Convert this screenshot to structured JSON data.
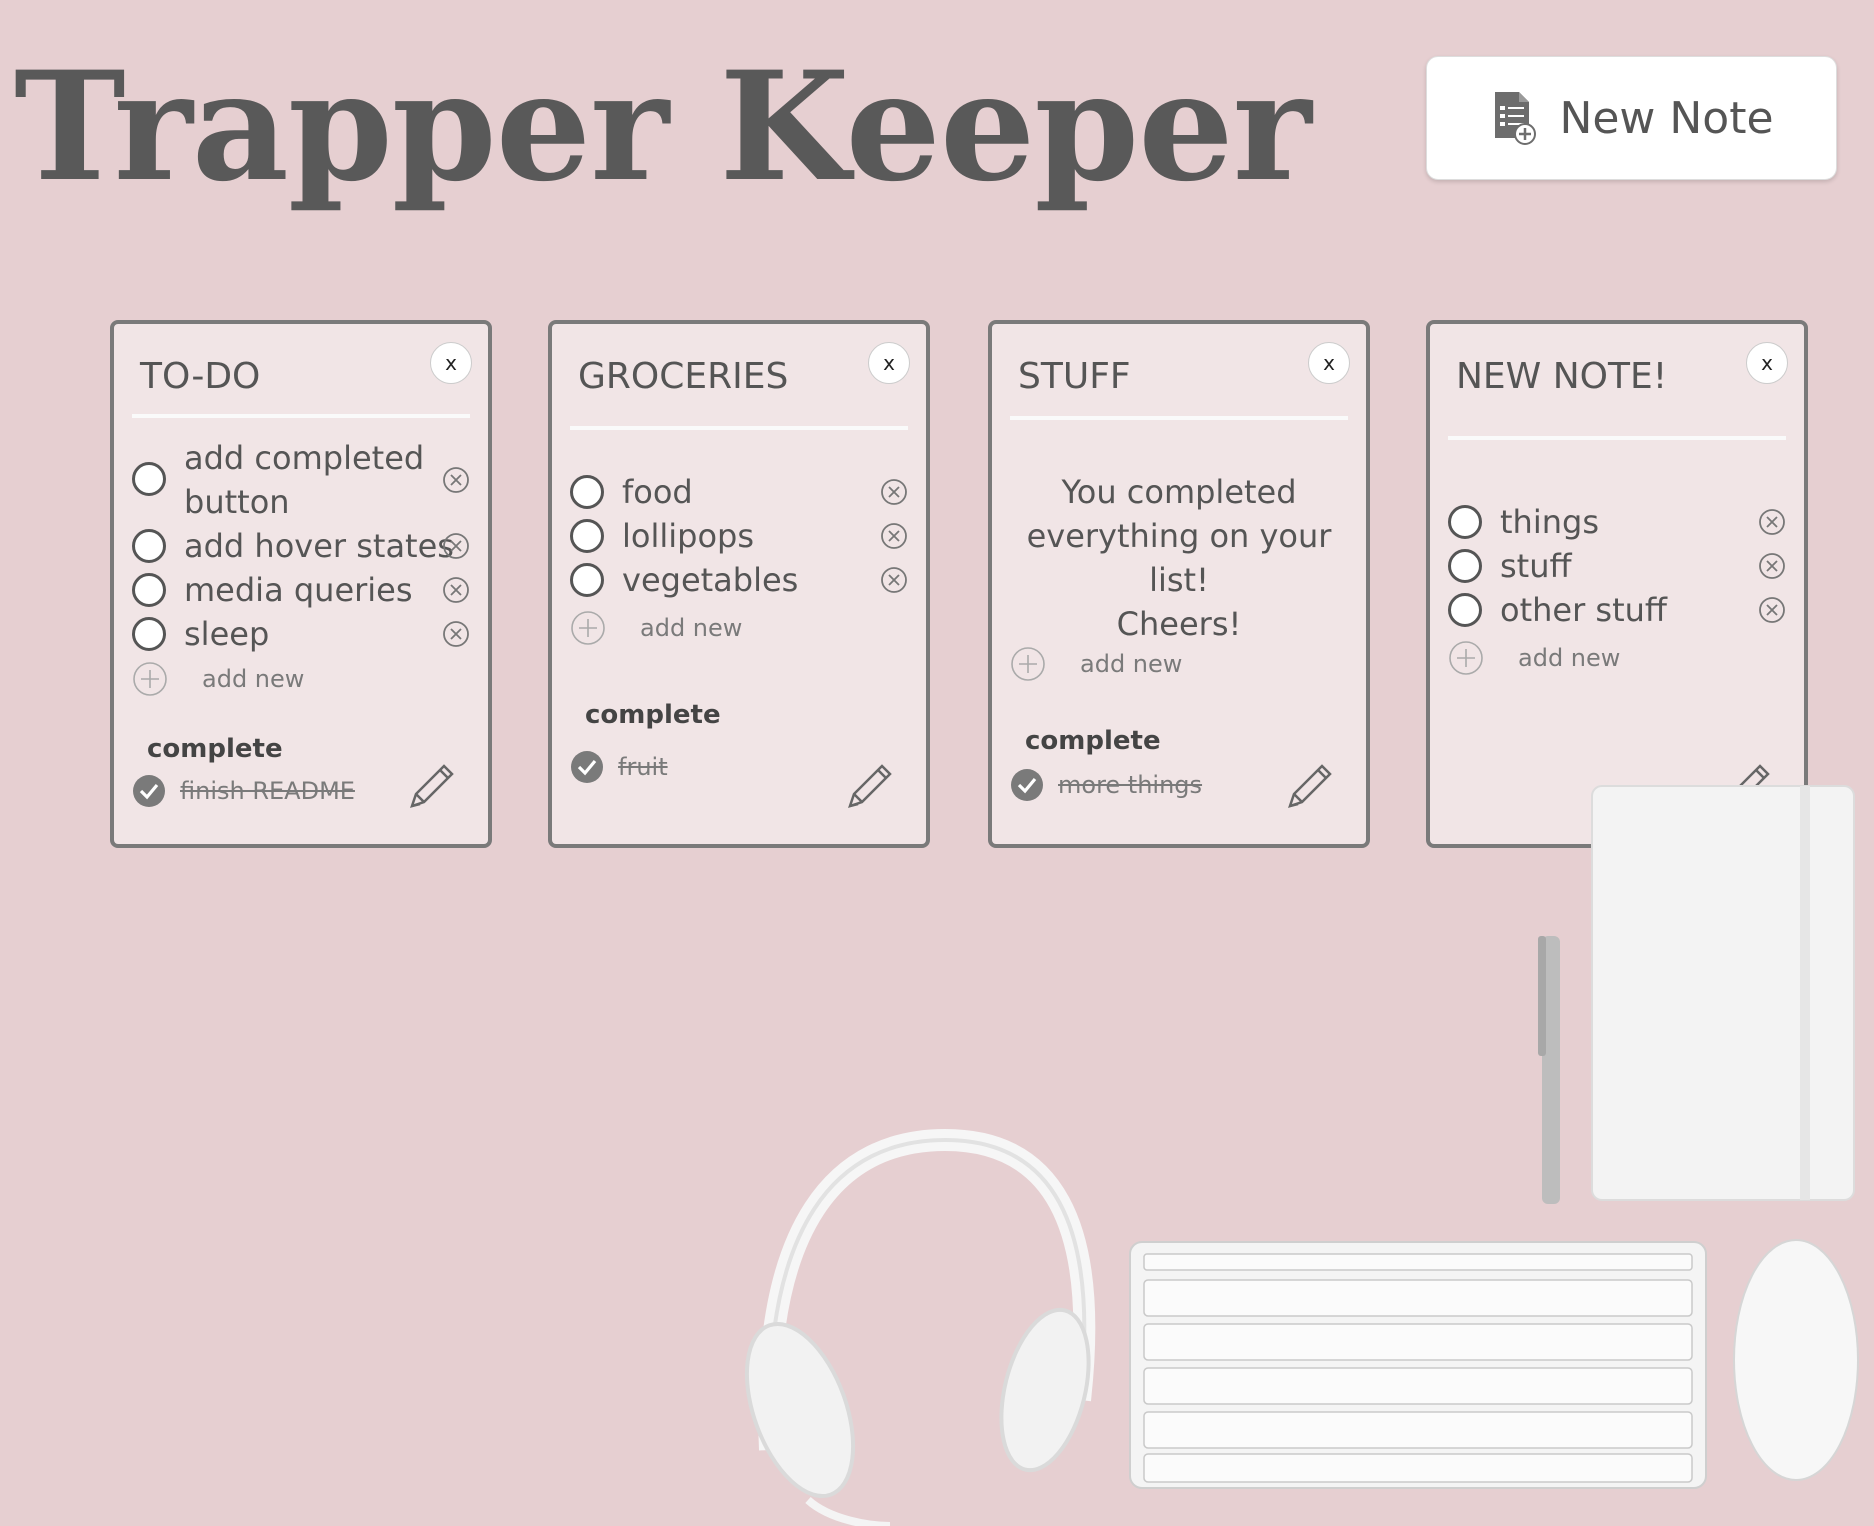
{
  "app": {
    "title": "Trapper Keeper",
    "new_note_label": "New Note"
  },
  "notes": [
    {
      "title": "TO-DO",
      "close_label": "x",
      "items": [
        "add completed",
        "button",
        "add hover states",
        "media queries",
        "sleep"
      ],
      "add_label": "add new",
      "complete_label": "complete",
      "completed": [
        "finish README"
      ]
    },
    {
      "title": "GROCERIES",
      "close_label": "x",
      "items": [
        "food",
        "lollipops",
        "vegetables"
      ],
      "add_label": "add new",
      "complete_label": "complete",
      "completed": [
        "fruit"
      ]
    },
    {
      "title": "STUFF",
      "close_label": "x",
      "empty_message": [
        "You completed",
        "everything on your list!",
        "Cheers!"
      ],
      "add_label": "add new",
      "complete_label": "complete",
      "completed": [
        "more things"
      ]
    },
    {
      "title": "NEW NOTE!",
      "close_label": "x",
      "items": [
        "things",
        "stuff",
        "other stuff"
      ],
      "add_label": "add new"
    }
  ],
  "colors": {
    "background": "#e6cfd1",
    "card": "#f1e5e6",
    "border": "#7a7a7a",
    "text": "#555555"
  },
  "icons": {
    "new_note": "note-add-icon",
    "close": "x",
    "delete": "circle-x-icon",
    "add": "circle-plus-icon",
    "done": "check-circle-icon",
    "edit": "pencil-icon"
  }
}
